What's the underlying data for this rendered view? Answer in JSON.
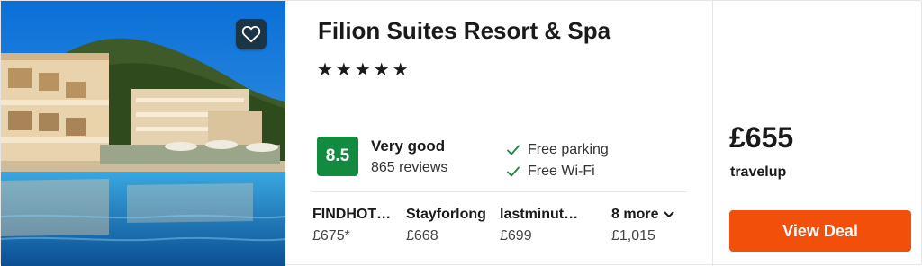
{
  "hotel": {
    "name": "Filion Suites Resort & Spa",
    "stars": "★★★★★",
    "star_count": 5,
    "rating_score": "8.5",
    "rating_label": "Very good",
    "reviews": "865 reviews",
    "amenities": [
      "Free parking",
      "Free Wi-Fi"
    ]
  },
  "offers": [
    {
      "provider": "FINDHOT…",
      "price": "£675*"
    },
    {
      "provider": "Stayforlong",
      "price": "£668"
    },
    {
      "provider": "lastminut…",
      "price": "£699"
    }
  ],
  "more_offers": {
    "label": "8 more",
    "price": "£1,015"
  },
  "deal": {
    "price": "£655",
    "provider": "travelup",
    "button_label": "View Deal"
  },
  "colors": {
    "rating_badge": "#128a40",
    "deal_button": "#f14f0a",
    "favorite_button": "#1b3446",
    "check_icon": "#128a40"
  },
  "icons": {
    "favorite": "heart-icon",
    "amenity": "check-icon",
    "more": "chevron-down-icon"
  }
}
